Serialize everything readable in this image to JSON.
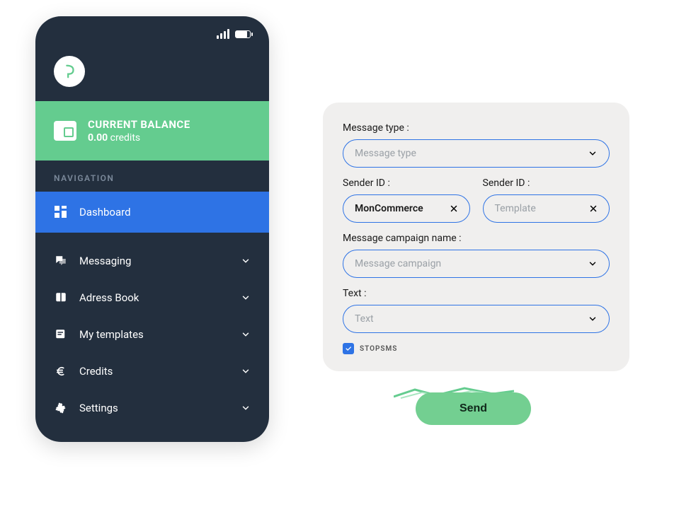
{
  "balance": {
    "title": "CURRENT BALANCE",
    "amount": "0.00",
    "unit": "credits"
  },
  "nav": {
    "header": "NAVIGATION",
    "items": [
      {
        "label": "Dashboard"
      },
      {
        "label": "Messaging"
      },
      {
        "label": "Adress Book"
      },
      {
        "label": "My templates"
      },
      {
        "label": "Credits"
      },
      {
        "label": "Settings"
      }
    ]
  },
  "form": {
    "message_type": {
      "label": "Message type :",
      "placeholder": "Message type"
    },
    "sender_id": {
      "label": "Sender ID :",
      "value": "MonCommerce"
    },
    "sender_id2": {
      "label": "Sender ID :",
      "placeholder": "Template"
    },
    "campaign": {
      "label": "Message campaign name :",
      "placeholder": "Message campaign"
    },
    "text": {
      "label": "Text :",
      "placeholder": "Text"
    },
    "stopsms": {
      "label": "STOPSMS",
      "checked": true
    },
    "send": "Send"
  }
}
